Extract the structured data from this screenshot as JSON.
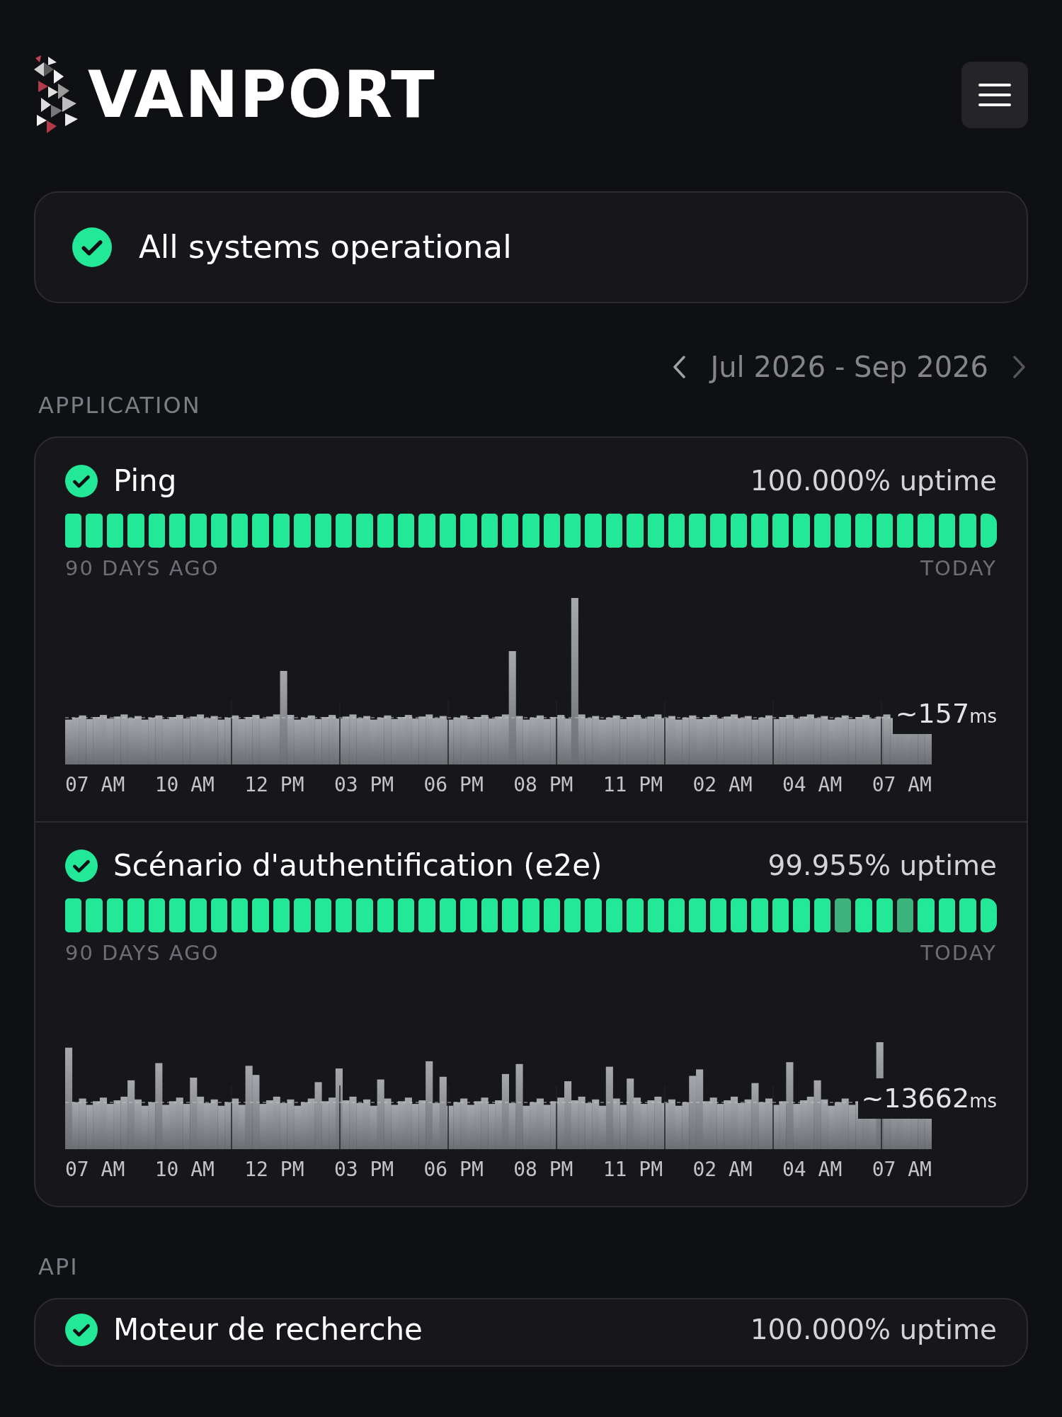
{
  "header": {
    "logo": "VANPORT"
  },
  "status": {
    "text": "All systems operational",
    "operational": true
  },
  "date_range": {
    "label": "Jul 2026 - Sep 2026"
  },
  "sections": [
    {
      "title": "APPLICATION",
      "monitors": [
        {
          "name": "Ping",
          "operational": true,
          "uptime": "100.000% uptime",
          "days": [
            {
              "degraded": false
            },
            {
              "degraded": false
            },
            {
              "degraded": false
            },
            {
              "degraded": false
            },
            {
              "degraded": false
            },
            {
              "degraded": false
            },
            {
              "degraded": false
            },
            {
              "degraded": false
            },
            {
              "degraded": false
            },
            {
              "degraded": false
            },
            {
              "degraded": false
            },
            {
              "degraded": false
            },
            {
              "degraded": false
            },
            {
              "degraded": false
            },
            {
              "degraded": false
            },
            {
              "degraded": false
            },
            {
              "degraded": false
            },
            {
              "degraded": false
            },
            {
              "degraded": false
            },
            {
              "degraded": false
            },
            {
              "degraded": false
            },
            {
              "degraded": false
            },
            {
              "degraded": false
            },
            {
              "degraded": false
            },
            {
              "degraded": false
            },
            {
              "degraded": false
            },
            {
              "degraded": false
            },
            {
              "degraded": false
            },
            {
              "degraded": false
            },
            {
              "degraded": false
            },
            {
              "degraded": false
            },
            {
              "degraded": false
            },
            {
              "degraded": false
            },
            {
              "degraded": false
            },
            {
              "degraded": false
            },
            {
              "degraded": false
            },
            {
              "degraded": false
            },
            {
              "degraded": false
            },
            {
              "degraded": false
            },
            {
              "degraded": false
            },
            {
              "degraded": false
            },
            {
              "degraded": false
            },
            {
              "degraded": false
            },
            {
              "degraded": false
            },
            {
              "degraded": false
            }
          ],
          "start_label": "90 DAYS AGO",
          "end_label": "TODAY",
          "latency": "~157",
          "latency_unit": "ms",
          "times": [
            "07 AM",
            "10 AM",
            "12 PM",
            "03 PM",
            "06 PM",
            "08 PM",
            "11 PM",
            "02 AM",
            "04 AM",
            "07 AM"
          ]
        },
        {
          "name": "Scénario d'authentification (e2e)",
          "operational": true,
          "uptime": "99.955% uptime",
          "days": [
            {
              "degraded": false
            },
            {
              "degraded": false
            },
            {
              "degraded": false
            },
            {
              "degraded": false
            },
            {
              "degraded": false
            },
            {
              "degraded": false
            },
            {
              "degraded": false
            },
            {
              "degraded": false
            },
            {
              "degraded": false
            },
            {
              "degraded": false
            },
            {
              "degraded": false
            },
            {
              "degraded": false
            },
            {
              "degraded": false
            },
            {
              "degraded": false
            },
            {
              "degraded": false
            },
            {
              "degraded": false
            },
            {
              "degraded": false
            },
            {
              "degraded": false
            },
            {
              "degraded": false
            },
            {
              "degraded": false
            },
            {
              "degraded": false
            },
            {
              "degraded": false
            },
            {
              "degraded": false
            },
            {
              "degraded": false
            },
            {
              "degraded": false
            },
            {
              "degraded": false
            },
            {
              "degraded": false
            },
            {
              "degraded": false
            },
            {
              "degraded": false
            },
            {
              "degraded": false
            },
            {
              "degraded": false
            },
            {
              "degraded": false
            },
            {
              "degraded": false
            },
            {
              "degraded": false
            },
            {
              "degraded": false
            },
            {
              "degraded": false
            },
            {
              "degraded": false
            },
            {
              "degraded": true
            },
            {
              "degraded": false
            },
            {
              "degraded": false
            },
            {
              "degraded": true
            },
            {
              "degraded": false
            },
            {
              "degraded": false
            },
            {
              "degraded": false
            },
            {
              "degraded": false
            }
          ],
          "start_label": "90 DAYS AGO",
          "end_label": "TODAY",
          "latency": "~13662",
          "latency_unit": "ms",
          "times": [
            "07 AM",
            "10 AM",
            "12 PM",
            "03 PM",
            "06 PM",
            "08 PM",
            "11 PM",
            "02 AM",
            "04 AM",
            "07 AM"
          ]
        }
      ]
    },
    {
      "title": "API",
      "monitors": [
        {
          "name": "Moteur de recherche",
          "operational": true,
          "uptime": "100.000% uptime"
        }
      ]
    }
  ]
}
